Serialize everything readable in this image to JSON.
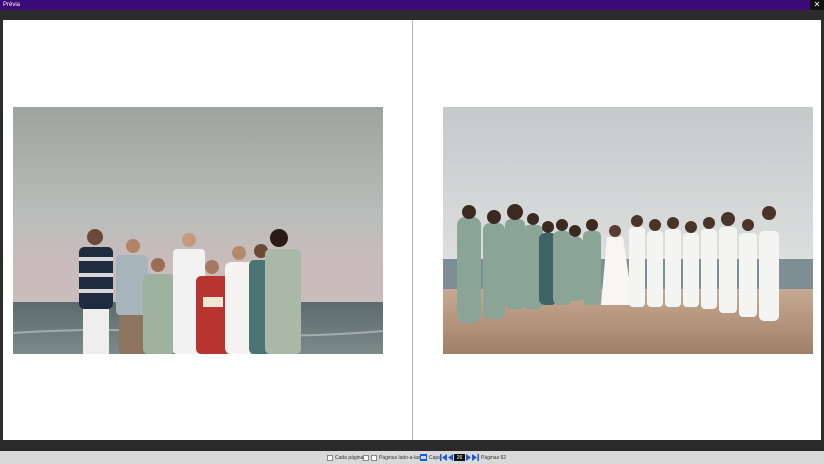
{
  "window": {
    "title": "Prévia",
    "close_glyph": "✕"
  },
  "toolbar": {
    "single_page_label": "Cada página",
    "facing_pages_label": "Páginas lado-a-lado",
    "cover_label": "Capa",
    "current_page": "26",
    "total_pages_label": "Páginas 62"
  },
  "icons": {
    "close": "close-icon",
    "checkbox": "checkbox-icon",
    "cover": "cover-icon",
    "first": "first-page-icon",
    "prev": "previous-page-icon",
    "next": "next-page-icon",
    "last": "last-page-icon"
  },
  "colors": {
    "titlebar": "#3a0a78",
    "nav_accent": "#1e5bd6",
    "background": "#2d2d2d"
  }
}
